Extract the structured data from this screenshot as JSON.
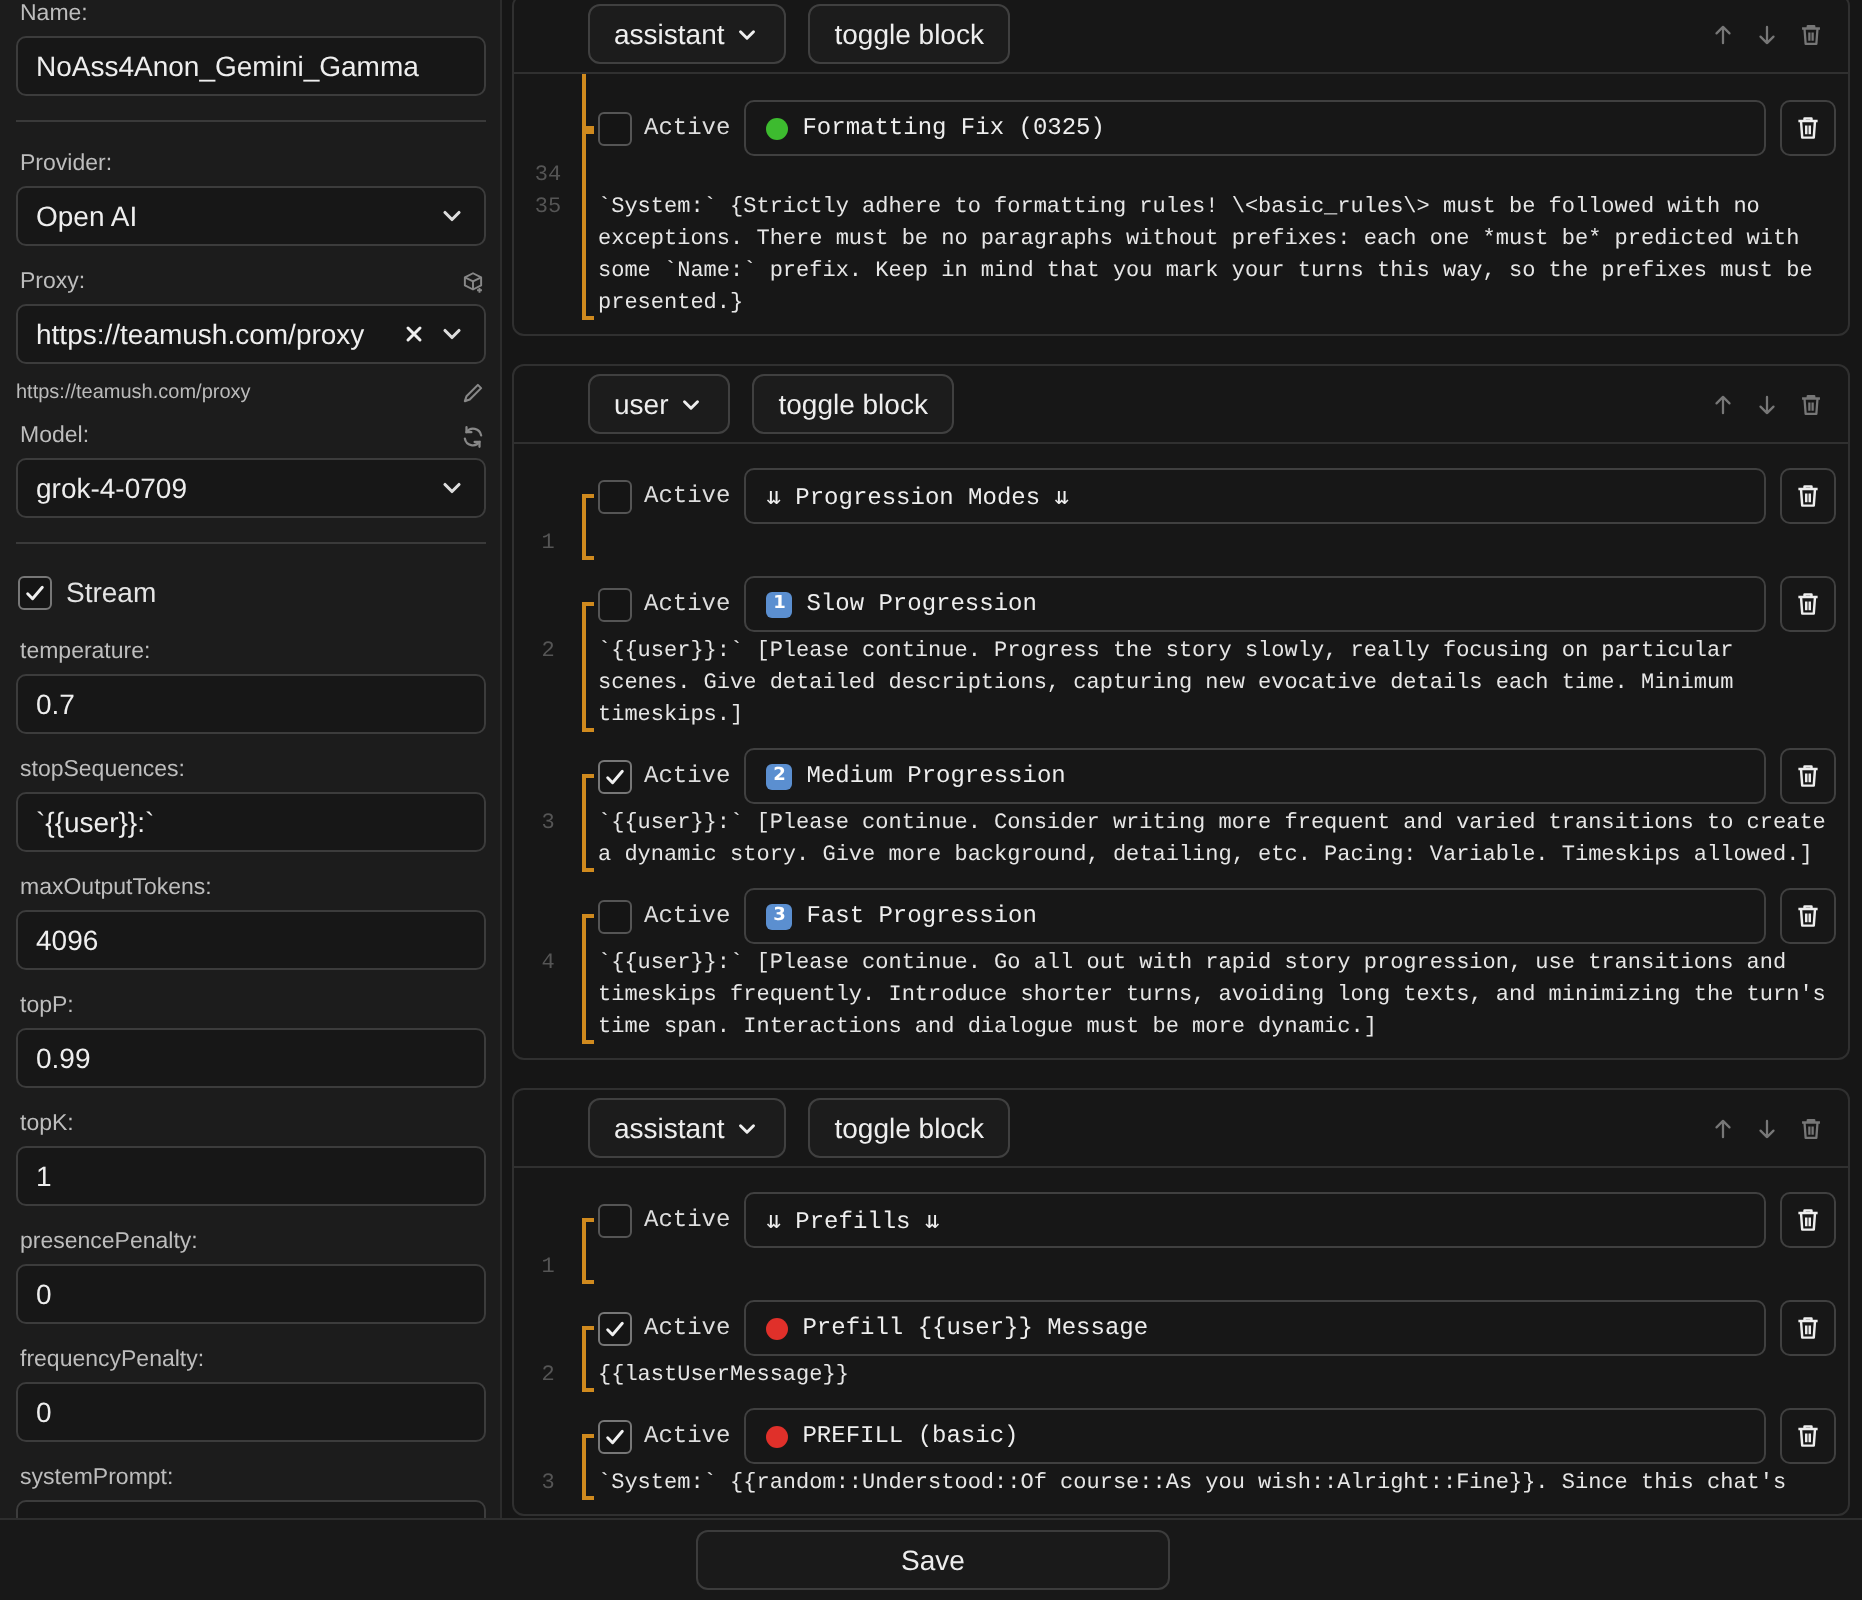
{
  "sidebar": {
    "fields": [
      {
        "kind": "text",
        "label": "Name:",
        "value": "NoAss4Anon_Gemini_Gamma"
      },
      {
        "kind": "divider"
      },
      {
        "kind": "select",
        "label": "Provider:",
        "value": "Open AI"
      },
      {
        "kind": "proxy",
        "label": "Proxy:",
        "value": "https://teamush.com/proxy",
        "url": "https://teamush.com/proxy"
      },
      {
        "kind": "model",
        "label": "Model:",
        "value": "grok-4-0709"
      },
      {
        "kind": "divider"
      },
      {
        "kind": "checkbox",
        "label": "Stream",
        "checked": true
      },
      {
        "kind": "text",
        "label": "temperature:",
        "value": "0.7"
      },
      {
        "kind": "text",
        "label": "stopSequences:",
        "value": "`{{user}}:`"
      },
      {
        "kind": "text",
        "label": "maxOutputTokens:",
        "value": "4096"
      },
      {
        "kind": "text",
        "label": "topP:",
        "value": "0.99"
      },
      {
        "kind": "text",
        "label": "topK:",
        "value": "1"
      },
      {
        "kind": "text",
        "label": "presencePenalty:",
        "value": "0"
      },
      {
        "kind": "text",
        "label": "frequencyPenalty:",
        "value": "0"
      },
      {
        "kind": "textarea",
        "label": "systemPrompt:"
      }
    ]
  },
  "blocks": [
    {
      "role": "assistant",
      "toggle": "toggle block",
      "cut_top": true,
      "items": [
        {
          "active": false,
          "label": "Active",
          "marker": {
            "kind": "dot",
            "color": "#3dbb2f"
          },
          "title": "Formatting Fix (0325)",
          "lines": [
            "34",
            "35"
          ],
          "content": "\n`System:` {Strictly adhere to formatting rules! \\<basic_rules\\> must be followed with no exceptions. There must be no paragraphs without prefixes: each one *must be* predicted with some `Name:` prefix. Keep in mind that you mark your turns this way, so the prefixes must be presented.}"
        }
      ]
    },
    {
      "role": "user",
      "toggle": "toggle block",
      "cut_top": false,
      "items": [
        {
          "active": false,
          "label": "Active",
          "title": "⇊ Progression Modes ⇊",
          "lines": [
            "1"
          ]
        },
        {
          "active": false,
          "label": "Active",
          "marker": {
            "kind": "keycap",
            "text": "1"
          },
          "title": "Slow Progression",
          "lines": [
            "2"
          ],
          "content": "`{{user}}:` [Please continue. Progress the story slowly, really focusing on particular scenes. Give detailed descriptions, capturing new evocative details each time. Minimum timeskips.]"
        },
        {
          "active": true,
          "label": "Active",
          "marker": {
            "kind": "keycap",
            "text": "2"
          },
          "title": "Medium Progression",
          "lines": [
            "3"
          ],
          "content": "`{{user}}:` [Please continue. Consider writing more frequent and varied transitions to create a dynamic story. Give more background, detailing, etc. Pacing: Variable. Timeskips allowed.]"
        },
        {
          "active": false,
          "label": "Active",
          "marker": {
            "kind": "keycap",
            "text": "3"
          },
          "title": "Fast Progression",
          "lines": [
            "4"
          ],
          "content": "`{{user}}:` [Please continue. Go all out with rapid story progression, use transitions and timeskips frequently. Introduce shorter turns, avoiding long texts, and minimizing the turn's time span. Interactions and dialogue must be more dynamic.]"
        }
      ]
    },
    {
      "role": "assistant",
      "toggle": "toggle block",
      "cut_top": false,
      "items": [
        {
          "active": false,
          "label": "Active",
          "title": "⇊ Prefills ⇊",
          "lines": [
            "1"
          ]
        },
        {
          "active": true,
          "label": "Active",
          "marker": {
            "kind": "dot",
            "color": "#e0302a"
          },
          "title": "Prefill {{user}} Message",
          "lines": [
            "2"
          ],
          "content": "{{lastUserMessage}}"
        },
        {
          "active": true,
          "label": "Active",
          "marker": {
            "kind": "dot",
            "color": "#e0302a"
          },
          "title": "PREFILL (basic)",
          "lines": [
            "3"
          ],
          "content": "`System:` {{random::Understood::Of course::As you wish::Alright::Fine}}. Since this chat's"
        }
      ]
    }
  ],
  "footer": {
    "save": "Save"
  }
}
